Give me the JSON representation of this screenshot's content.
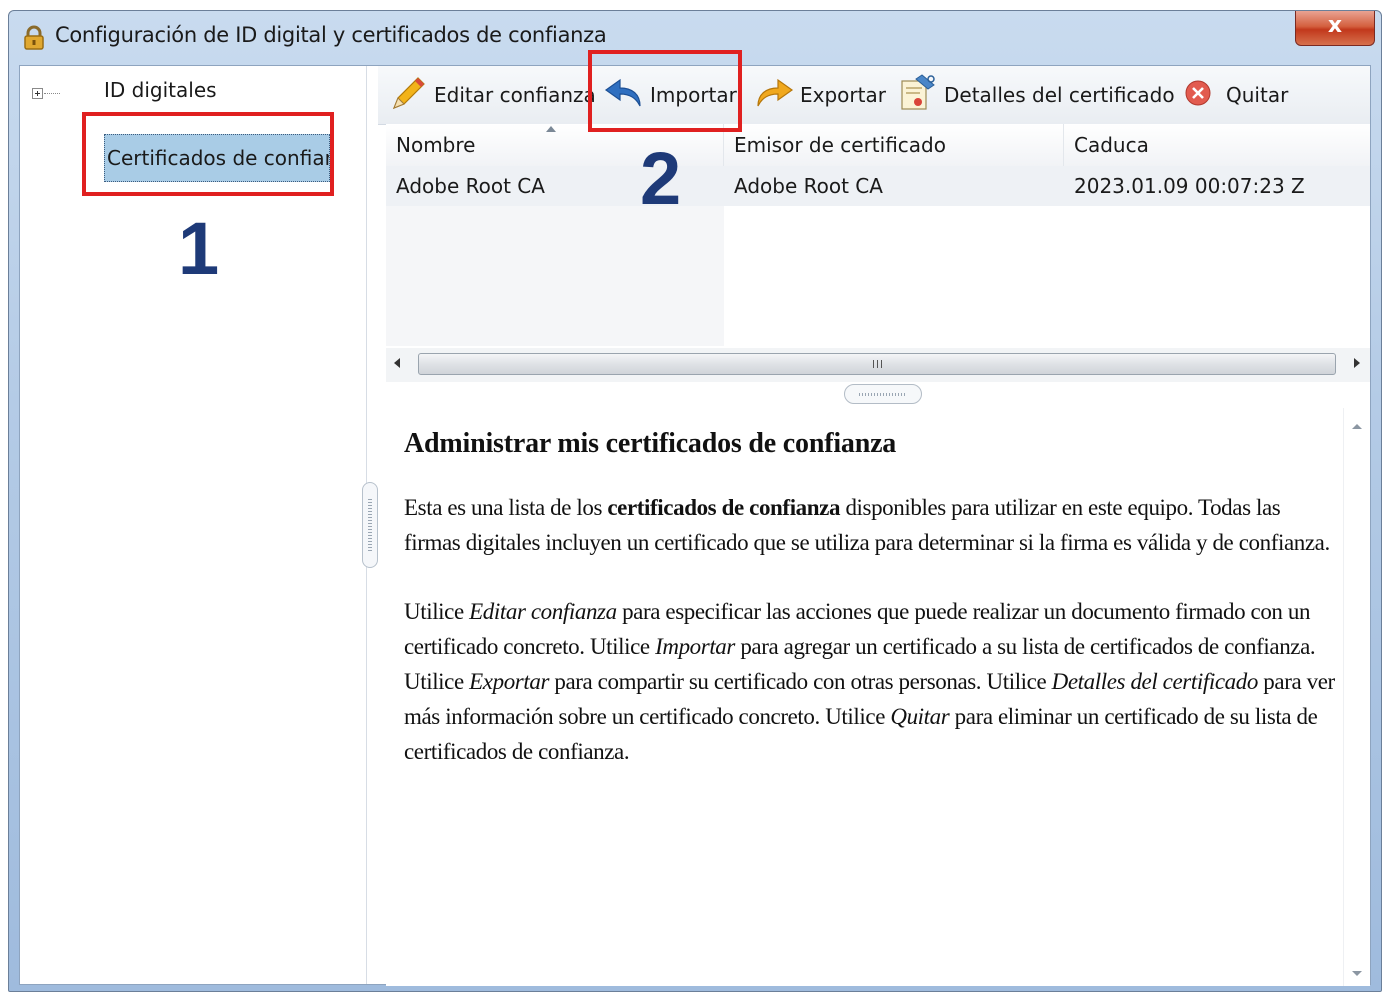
{
  "window": {
    "title": "Configuración de ID digital y certificados de confianza",
    "close_label": "x"
  },
  "tree": {
    "items": [
      {
        "label": "ID digitales"
      },
      {
        "label": "Certificados de confianza"
      }
    ]
  },
  "toolbar": {
    "edit_label": "Editar confianza",
    "import_label": "Importar",
    "export_label": "Exportar",
    "details_label": "Detalles del certificado",
    "remove_label": "Quitar"
  },
  "table": {
    "columns": [
      "Nombre",
      "Emisor de certificado",
      "Caduca"
    ],
    "rows": [
      [
        "Adobe Root CA",
        "Adobe Root CA",
        "2023.01.09 00:07:23 Z"
      ]
    ]
  },
  "annotations": {
    "step1": "1",
    "step2": "2"
  },
  "description": {
    "heading": "Administrar mis certificados de confianza",
    "p1_a": "Esta es una lista de los ",
    "p1_b": "certificados de confianza",
    "p1_c": " disponibles para utilizar en este equipo. Todas las firmas digitales incluyen un certificado que se utiliza para determinar si la firma es válida y de confianza.",
    "p2_a": "Utilice ",
    "p2_b": "Editar confianza",
    "p2_c": " para especificar las acciones que puede realizar un documento firmado con un certificado concreto. Utilice ",
    "p2_d": "Importar",
    "p2_e": " para agregar un certificado a su lista de certificados de confianza. Utilice ",
    "p2_f": "Exportar",
    "p2_g": " para compartir su certificado con otras personas. Utilice ",
    "p2_h": "Detalles del certificado",
    "p2_i": " para ver más información sobre un certificado concreto. Utilice ",
    "p2_j": "Quitar",
    "p2_k": " para eliminar un certificado de su lista de certificados de confianza."
  },
  "colors": {
    "callout": "#e02020",
    "step_number": "#1e3a78",
    "selection": "#a9cce6"
  },
  "icons": [
    "padlock-icon",
    "close-icon",
    "pencil-icon",
    "import-arrow-icon",
    "export-arrow-icon",
    "certificate-icon",
    "remove-icon"
  ]
}
